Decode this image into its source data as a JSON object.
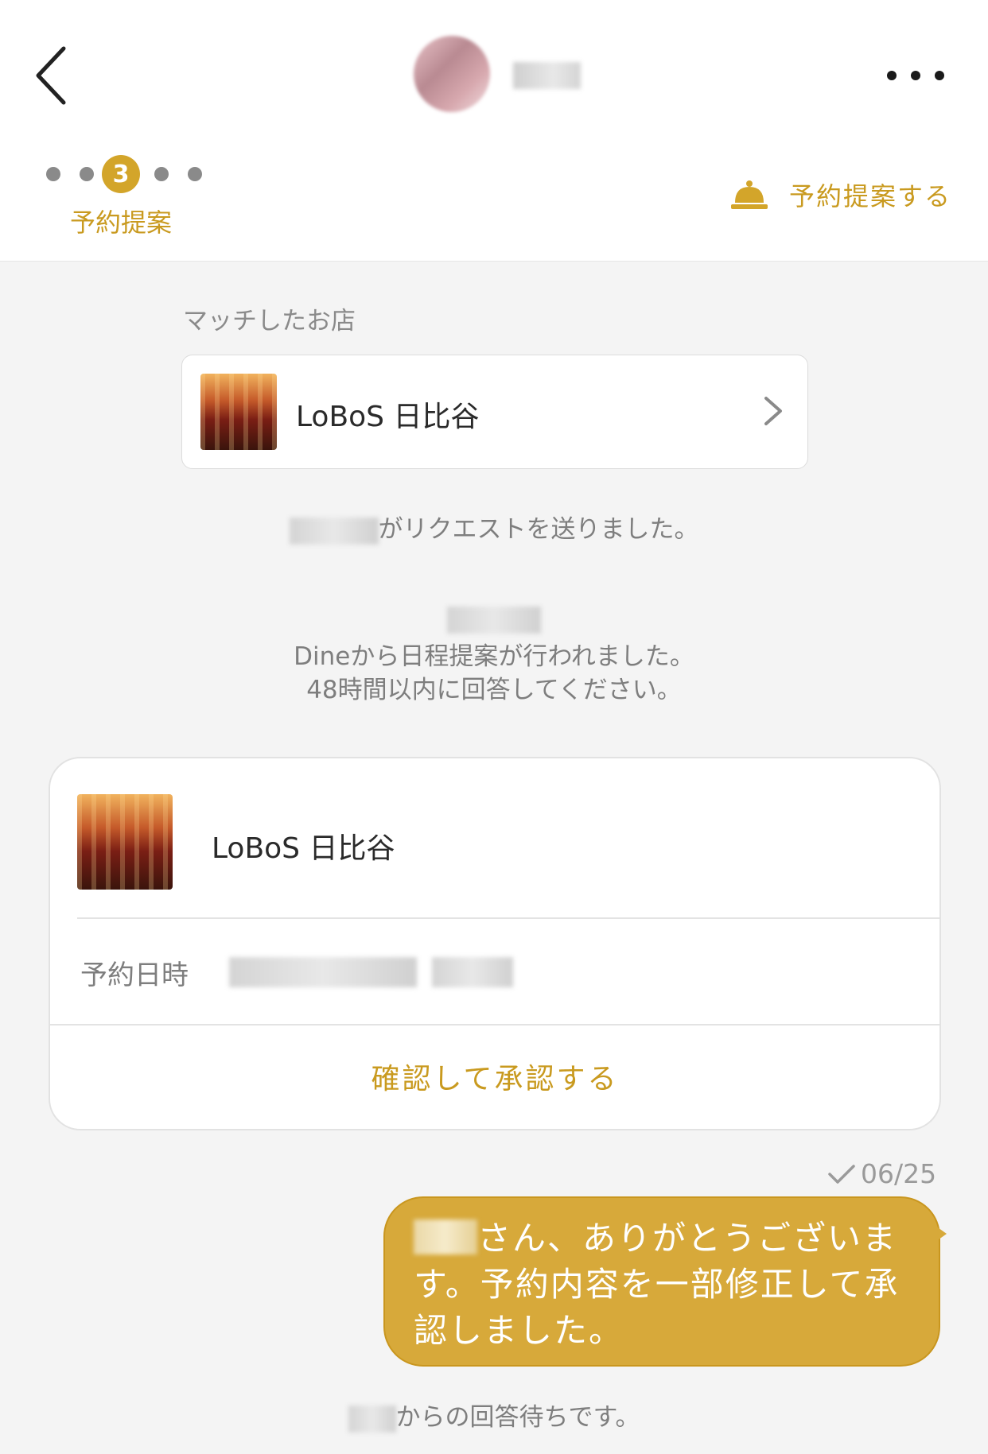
{
  "header": {
    "step_number": "3",
    "step_label": "予約提案",
    "propose_button_label": "予約提案する"
  },
  "matched": {
    "section_label": "マッチしたお店",
    "shop_name": "LoBoS 日比谷"
  },
  "messages": {
    "request_sent": "がリクエストを送りました。",
    "dine_line1": "Dineから日程提案が行われました。",
    "dine_line2": "48時間以内に回答してください。"
  },
  "proposal": {
    "shop_name": "LoBoS 日比谷",
    "datetime_label": "予約日時",
    "approve_label": "確認して承認する"
  },
  "chat": {
    "date": "06/25",
    "bubble_text": "さん、ありがとうございます。予約内容を一部修正して承認しました。"
  },
  "footer": {
    "waiting_text": "からの回答待ちです。"
  },
  "colors": {
    "accent": "#d3a52a",
    "accent_text": "#c99a1f",
    "bubble": "#d7a93a",
    "background": "#f4f4f4"
  },
  "icons": [
    "back-arrow-icon",
    "more-dots-icon",
    "bell-icon",
    "chevron-right-icon",
    "checkmark-icon"
  ]
}
